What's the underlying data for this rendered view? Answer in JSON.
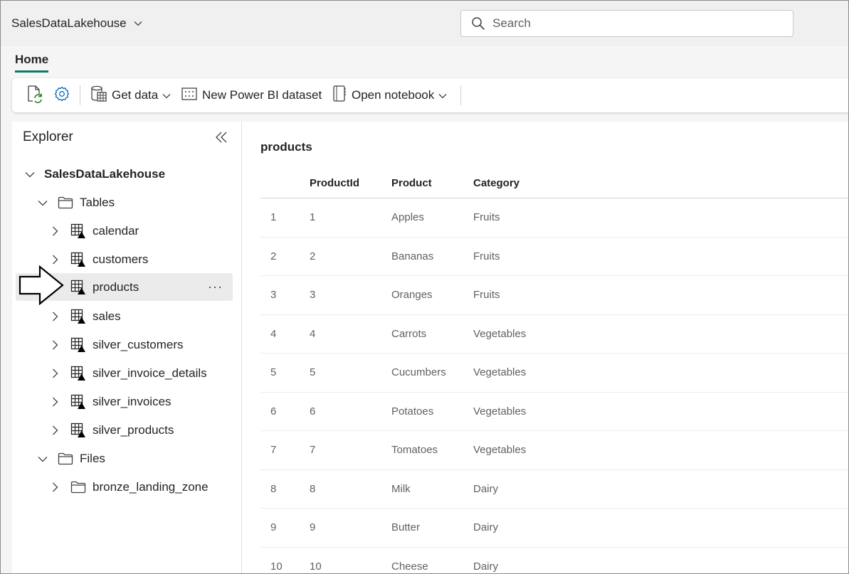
{
  "app": {
    "title": "SalesDataLakehouse"
  },
  "search": {
    "placeholder": "Search"
  },
  "tabs": [
    {
      "label": "Home"
    }
  ],
  "toolbar": {
    "get_data_label": "Get data",
    "new_dataset_label": "New Power BI dataset",
    "open_notebook_label": "Open notebook"
  },
  "explorer": {
    "title": "Explorer",
    "root": "SalesDataLakehouse",
    "tables_label": "Tables",
    "tables": [
      "calendar",
      "customers",
      "products",
      "sales",
      "silver_customers",
      "silver_invoice_details",
      "silver_invoices",
      "silver_products"
    ],
    "selected_table": "products",
    "files_label": "Files",
    "files": [
      "bronze_landing_zone"
    ]
  },
  "preview": {
    "title": "products",
    "columns": [
      "ProductId",
      "Product",
      "Category"
    ],
    "rows": [
      [
        "1",
        "1",
        "Apples",
        "Fruits"
      ],
      [
        "2",
        "2",
        "Bananas",
        "Fruits"
      ],
      [
        "3",
        "3",
        "Oranges",
        "Fruits"
      ],
      [
        "4",
        "4",
        "Carrots",
        "Vegetables"
      ],
      [
        "5",
        "5",
        "Cucumbers",
        "Vegetables"
      ],
      [
        "6",
        "6",
        "Potatoes",
        "Vegetables"
      ],
      [
        "7",
        "7",
        "Tomatoes",
        "Vegetables"
      ],
      [
        "8",
        "8",
        "Milk",
        "Dairy"
      ],
      [
        "9",
        "9",
        "Butter",
        "Dairy"
      ],
      [
        "10",
        "10",
        "Cheese",
        "Dairy"
      ]
    ]
  },
  "colors": {
    "accent": "#117865",
    "selected_row": "#ebebeb",
    "icon_blue": "#0f6cbd",
    "icon_green": "#107c10"
  }
}
